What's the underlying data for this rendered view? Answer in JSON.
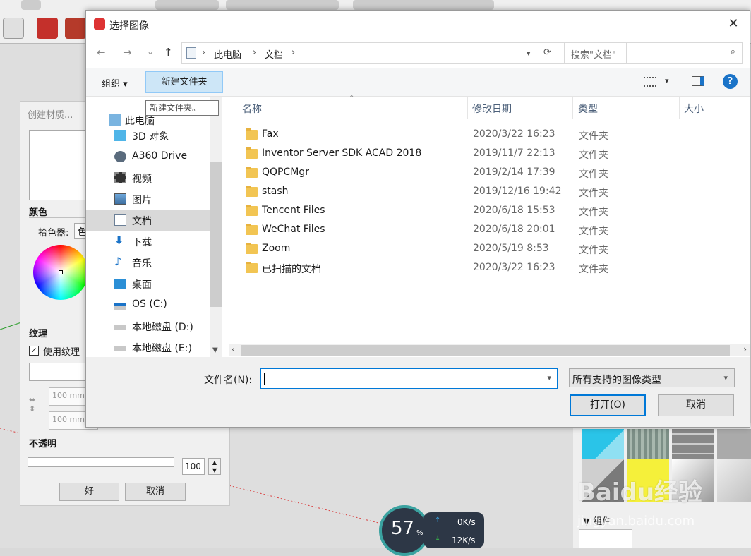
{
  "dialog": {
    "title": "选择图像",
    "close_symbol": "✕",
    "nav": {
      "back": "←",
      "forward": "→",
      "history": "⌄",
      "up": "↑"
    },
    "breadcrumb": [
      "此电脑",
      "文档"
    ],
    "search_placeholder": "搜索\"文档\"",
    "organize_label": "组织 ▾",
    "new_folder_label": "新建文件夹",
    "new_folder_tooltip": "新建文件夹。",
    "help_label": "?",
    "sidebar_items": [
      {
        "label": "此电脑",
        "icon": "computer-icon"
      },
      {
        "label": "3D 对象",
        "icon": "cube-icon"
      },
      {
        "label": "A360 Drive",
        "icon": "cloud-drive-icon"
      },
      {
        "label": "视频",
        "icon": "video-icon"
      },
      {
        "label": "图片",
        "icon": "picture-icon"
      },
      {
        "label": "文档",
        "icon": "document-icon",
        "selected": true
      },
      {
        "label": "下载",
        "icon": "download-icon"
      },
      {
        "label": "音乐",
        "icon": "music-icon"
      },
      {
        "label": "桌面",
        "icon": "desktop-icon"
      },
      {
        "label": "OS (C:)",
        "icon": "system-drive-icon"
      },
      {
        "label": "本地磁盘 (D:)",
        "icon": "disk-icon"
      },
      {
        "label": "本地磁盘 (E:)",
        "icon": "disk-icon"
      }
    ],
    "columns": {
      "name": "名称",
      "date": "修改日期",
      "type": "类型",
      "size": "大小"
    },
    "files": [
      {
        "name": "Fax",
        "date": "2020/3/22 16:23",
        "type": "文件夹"
      },
      {
        "name": "Inventor Server SDK ACAD 2018",
        "date": "2019/11/7 22:13",
        "type": "文件夹"
      },
      {
        "name": "QQPCMgr",
        "date": "2019/2/14 17:39",
        "type": "文件夹"
      },
      {
        "name": "stash",
        "date": "2019/12/16 19:42",
        "type": "文件夹"
      },
      {
        "name": "Tencent Files",
        "date": "2020/6/18 15:53",
        "type": "文件夹"
      },
      {
        "name": "WeChat Files",
        "date": "2020/6/18 20:01",
        "type": "文件夹"
      },
      {
        "name": "Zoom",
        "date": "2020/5/19 8:53",
        "type": "文件夹"
      },
      {
        "name": "已扫描的文档",
        "date": "2020/3/22 16:23",
        "type": "文件夹"
      }
    ],
    "filename_label": "文件名(N):",
    "filename_value": "",
    "filetype_value": "所有支持的图像类型",
    "open_label": "打开(O)",
    "cancel_label": "取消"
  },
  "material_panel": {
    "title": "创建材质...",
    "color_heading": "颜色",
    "picker_label": "拾色器:",
    "picker_value": "色",
    "texture_heading": "纹理",
    "use_texture_label": "使用纹理",
    "width_value": "100 mm",
    "height_value": "100 mm",
    "opacity_heading": "不透明",
    "opacity_value": "100",
    "ok_label": "好",
    "cancel_label": "取消"
  },
  "right_panel": {
    "components_label": "▼ 组件"
  },
  "network_widget": {
    "percent": "57",
    "percent_unit": "%",
    "upload": "0K/s",
    "download": "12K/s"
  },
  "watermark": {
    "line1": "Baidu经验",
    "line2": "jingyan.baidu.com"
  },
  "colors": {
    "accent": "#0078d7",
    "selected_bg": "#cce8ff",
    "folder": "#f2c553"
  }
}
